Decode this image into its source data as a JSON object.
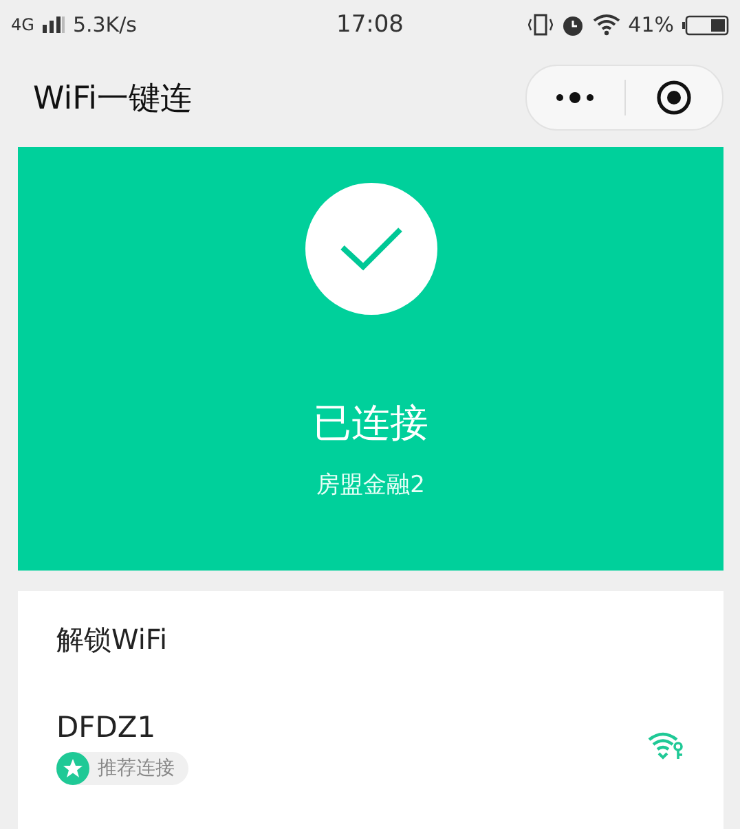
{
  "status_bar": {
    "network": "4G",
    "speed": "5.3K/s",
    "time": "17:08",
    "battery": "41%"
  },
  "nav_bar": {
    "title": "WiFi一键连"
  },
  "connection": {
    "connected": true,
    "status": "已连接",
    "ssid": "房盟金融2"
  },
  "unlock_list": {
    "title": "解锁WiFi",
    "networks": [
      {
        "name": "DFDZ1",
        "tag": "推荐连接"
      }
    ]
  }
}
